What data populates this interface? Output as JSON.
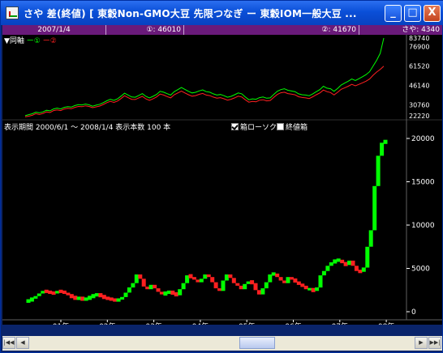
{
  "window": {
    "title": "さや 差(終値) [ 東穀Non-GMO大豆 先限つなぎ ー 東穀IOM一般大豆 ...",
    "minimize_symbol": "_",
    "maximize_symbol": "□",
    "close_symbol": "X"
  },
  "infobar": {
    "date": "2007/1/4",
    "s1": "①: 46010",
    "s2": "②: 41670",
    "spread": "さや: 4340"
  },
  "upper": {
    "legend_prefix": "▼同軸",
    "legend_1": "ー①",
    "legend_2": "ー②",
    "y_ticks": [
      "83740",
      "76900",
      "61520",
      "46140",
      "30760",
      "22220"
    ],
    "y_values": [
      83740,
      76900,
      61520,
      46140,
      30760,
      22220
    ]
  },
  "options": {
    "period_label": "表示期間 2000/6/1 ～ 2008/1/4 表示本数 100 本",
    "candle_label": "箱ローソク",
    "candle_checked": true,
    "close_label": "終値箱",
    "close_checked": false
  },
  "colors": {
    "series1": "#00ff00",
    "series2": "#ff2020",
    "up_box": "#00ff00",
    "down_box": "#ff2020",
    "title_gradient_top": "#2b6ff0",
    "infobar": "#6a1a7a"
  },
  "chart_data": {
    "type": "line",
    "upper_series": [
      {
        "name": "①",
        "values": [
          22300,
          23100,
          23800,
          25100,
          24600,
          25300,
          26600,
          26100,
          27600,
          28300,
          27600,
          28900,
          29400,
          29100,
          30300,
          31000,
          30800,
          31500,
          30900,
          29800,
          30600,
          31300,
          32600,
          34100,
          35300,
          34400,
          35600,
          37800,
          40100,
          38600,
          37100,
          36900,
          38300,
          39800,
          37600,
          36300,
          37600,
          39100,
          41600,
          40900,
          39700,
          38600,
          41300,
          42900,
          44600,
          43100,
          41600,
          40300,
          40800,
          41900,
          42700,
          41300,
          40900,
          39600,
          38600,
          39100,
          38100,
          36900,
          37600,
          38900,
          40300,
          39600,
          37100,
          34900,
          35600,
          35300,
          36600,
          37100,
          36100,
          36400,
          39100,
          41600,
          42900,
          43600,
          42400,
          41800,
          41300,
          39600,
          38900,
          38600,
          38100,
          39600,
          41300,
          42900,
          45600,
          44100,
          43600,
          41600,
          43900,
          46600,
          48100,
          49600,
          51300,
          50100,
          51600,
          53100,
          54800,
          57100,
          61600,
          66100,
          71600,
          83740
        ]
      },
      {
        "name": "②",
        "values": [
          21400,
          21900,
          22600,
          23900,
          23300,
          24100,
          25300,
          24800,
          26300,
          26900,
          26300,
          27600,
          28100,
          27800,
          28900,
          29600,
          29400,
          30100,
          29600,
          28600,
          29300,
          29900,
          31200,
          32600,
          33600,
          32800,
          33900,
          35900,
          38100,
          36600,
          35200,
          35100,
          36400,
          37600,
          35600,
          34400,
          35600,
          37100,
          39400,
          38600,
          37400,
          36400,
          38900,
          40300,
          41700,
          40300,
          38900,
          37700,
          38200,
          39200,
          39900,
          38600,
          38200,
          37000,
          36200,
          36600,
          35700,
          34600,
          35300,
          36400,
          37700,
          37100,
          34900,
          33000,
          33600,
          33300,
          34500,
          34900,
          34000,
          34300,
          36700,
          39100,
          40400,
          40900,
          39800,
          39300,
          38800,
          37300,
          36700,
          36400,
          35900,
          37300,
          38900,
          40300,
          42600,
          41300,
          40600,
          38700,
          40800,
          43200,
          44400,
          45600,
          47100,
          45900,
          47100,
          48300,
          49600,
          51300,
          54300,
          56800,
          58900,
          61520
        ]
      }
    ],
    "upper_ylim": [
      22220,
      83740
    ],
    "lower_type": "bar",
    "lower_values": [
      1300,
      1500,
      1800,
      2100,
      2400,
      2300,
      2200,
      2100,
      2400,
      2300,
      2200,
      1900,
      1700,
      1500,
      1600,
      1400,
      1500,
      1700,
      1900,
      2000,
      1800,
      1600,
      1500,
      1400,
      1300,
      1400,
      1700,
      2200,
      2800,
      3300,
      4300,
      3800,
      2900,
      2600,
      3100,
      2700,
      2300,
      2000,
      2200,
      2300,
      2100,
      1900,
      2600,
      3300,
      4200,
      4000,
      3700,
      3400,
      3800,
      4300,
      4000,
      3400,
      2700,
      2400,
      3600,
      4300,
      3900,
      3300,
      3000,
      2600,
      3200,
      3500,
      3300,
      2500,
      2000,
      2700,
      3400,
      4300,
      4400,
      4000,
      3600,
      3300,
      4000,
      3700,
      3500,
      3100,
      3000,
      2600,
      2600,
      2400,
      2800,
      4200,
      4700,
      5300,
      5700,
      5900,
      6000,
      5600,
      5400,
      5900,
      5300,
      4700,
      4600,
      5100,
      7500,
      9400,
      14500,
      18000,
      19500,
      19700
    ],
    "lower_ylim": [
      0,
      20000
    ],
    "lower_yticks": [
      0,
      5000,
      10000,
      15000,
      20000
    ],
    "lower_ytick_labels": [
      "0",
      "5000",
      "10000",
      "15000",
      "20000"
    ],
    "xtick_labels": [
      "01年",
      "02年",
      "03年",
      "04年",
      "05年",
      "06年",
      "07年",
      "08年"
    ]
  },
  "scrollbar": {
    "first": "|◀◀",
    "prev": "◀",
    "next": "▶",
    "last": "▶▶|"
  }
}
